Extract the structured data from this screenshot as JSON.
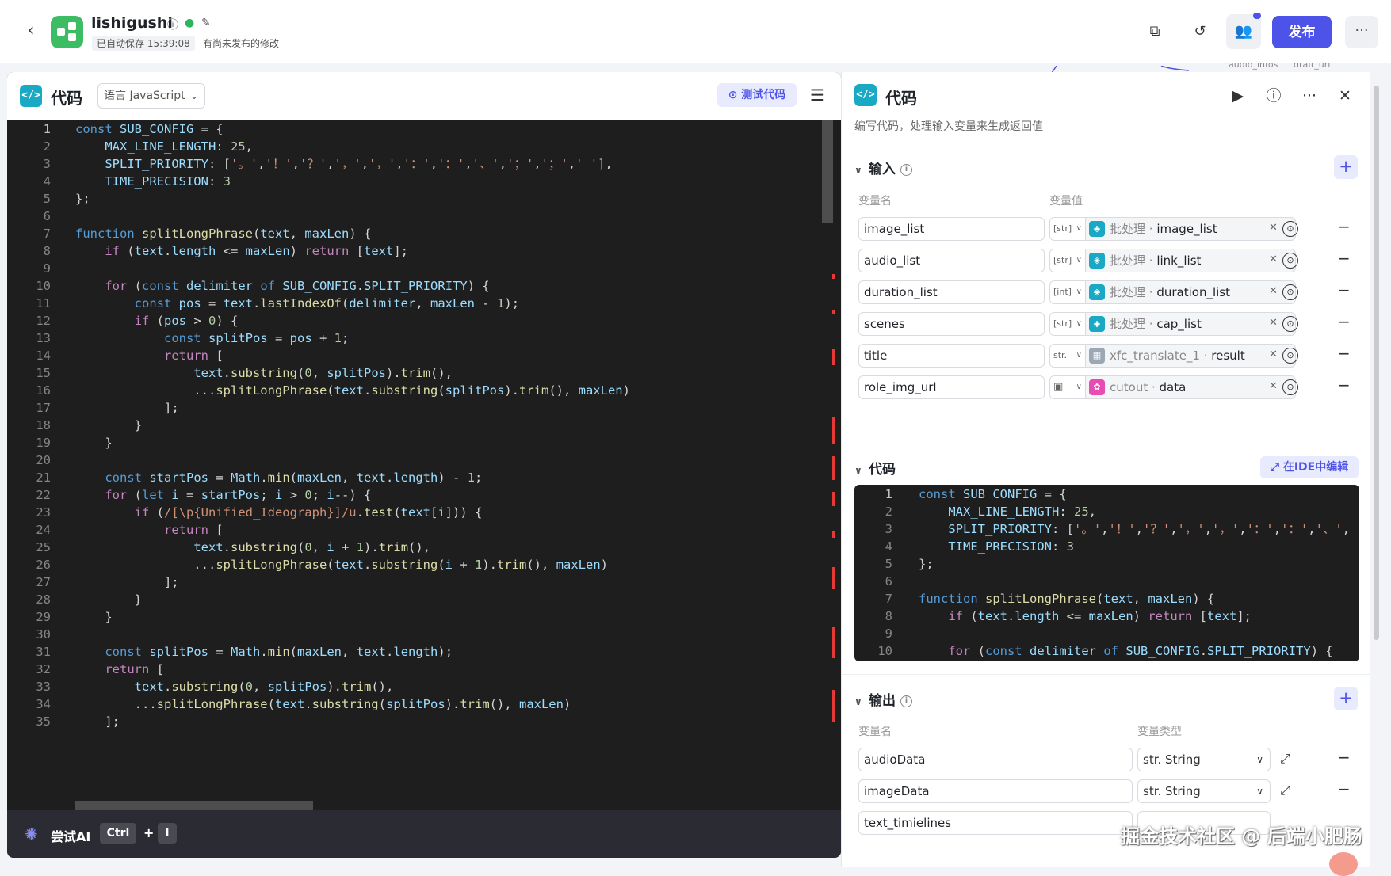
{
  "topbar": {
    "back_icon": "chevron-left-icon",
    "app_name": "lishigushi",
    "autosave": "已自动保存 15:39:08",
    "unpublished": "有尚未发布的修改",
    "publish_label": "发布",
    "icons": [
      "copy-icon",
      "history-icon",
      "collaborators-icon",
      "more-icon"
    ]
  },
  "canvas_edge": {
    "labels": [
      "audio_infos",
      "draft_url"
    ]
  },
  "left_panel": {
    "title": "代码",
    "language_select": "语言 JavaScript",
    "test_button": "测试代码",
    "footer": {
      "ai_label": "尝试AI",
      "key1": "Ctrl",
      "plus": "+",
      "key2": "I"
    },
    "line_numbers": [
      "1",
      "2",
      "3",
      "4",
      "5",
      "6",
      "7",
      "8",
      "9",
      "10",
      "11",
      "12",
      "13",
      "14",
      "15",
      "16",
      "17",
      "18",
      "19",
      "20",
      "21",
      "22",
      "23",
      "24",
      "25",
      "26",
      "27",
      "28",
      "29",
      "30",
      "31",
      "32",
      "33",
      "34",
      "35"
    ]
  },
  "right_panel": {
    "title": "代码",
    "subtitle": "编写代码，处理输入变量来生成返回值",
    "input_section": {
      "title": "输入",
      "col_name": "变量名",
      "col_value": "变量值",
      "rows": [
        {
          "name": "image_list",
          "type": "[str]",
          "source": "批处理",
          "field": "image_list"
        },
        {
          "name": "audio_list",
          "type": "[str]",
          "source": "批处理",
          "field": "link_list"
        },
        {
          "name": "duration_list",
          "type": "[int]",
          "source": "批处理",
          "field": "duration_list"
        },
        {
          "name": "scenes",
          "type": "[str]",
          "source": "批处理",
          "field": "cap_list"
        },
        {
          "name": "title",
          "type": "str.",
          "source": "xfc_translate_1",
          "field": "result"
        },
        {
          "name": "role_img_url",
          "type": "",
          "source": "cutout",
          "field": "data"
        }
      ]
    },
    "code_section": {
      "title": "代码",
      "ide_button": "在IDE中编辑",
      "line_numbers": [
        "1",
        "2",
        "3",
        "4",
        "5",
        "6",
        "7",
        "8",
        "9",
        "10"
      ]
    },
    "output_section": {
      "title": "输出",
      "col_name": "变量名",
      "col_type": "变量类型",
      "rows": [
        {
          "name": "audioData",
          "type": "str. String"
        },
        {
          "name": "imageData",
          "type": "str. String"
        },
        {
          "name": "text_timielines",
          "type": ""
        }
      ]
    }
  },
  "watermark": "掘金技术社区 @ 后端小肥肠"
}
